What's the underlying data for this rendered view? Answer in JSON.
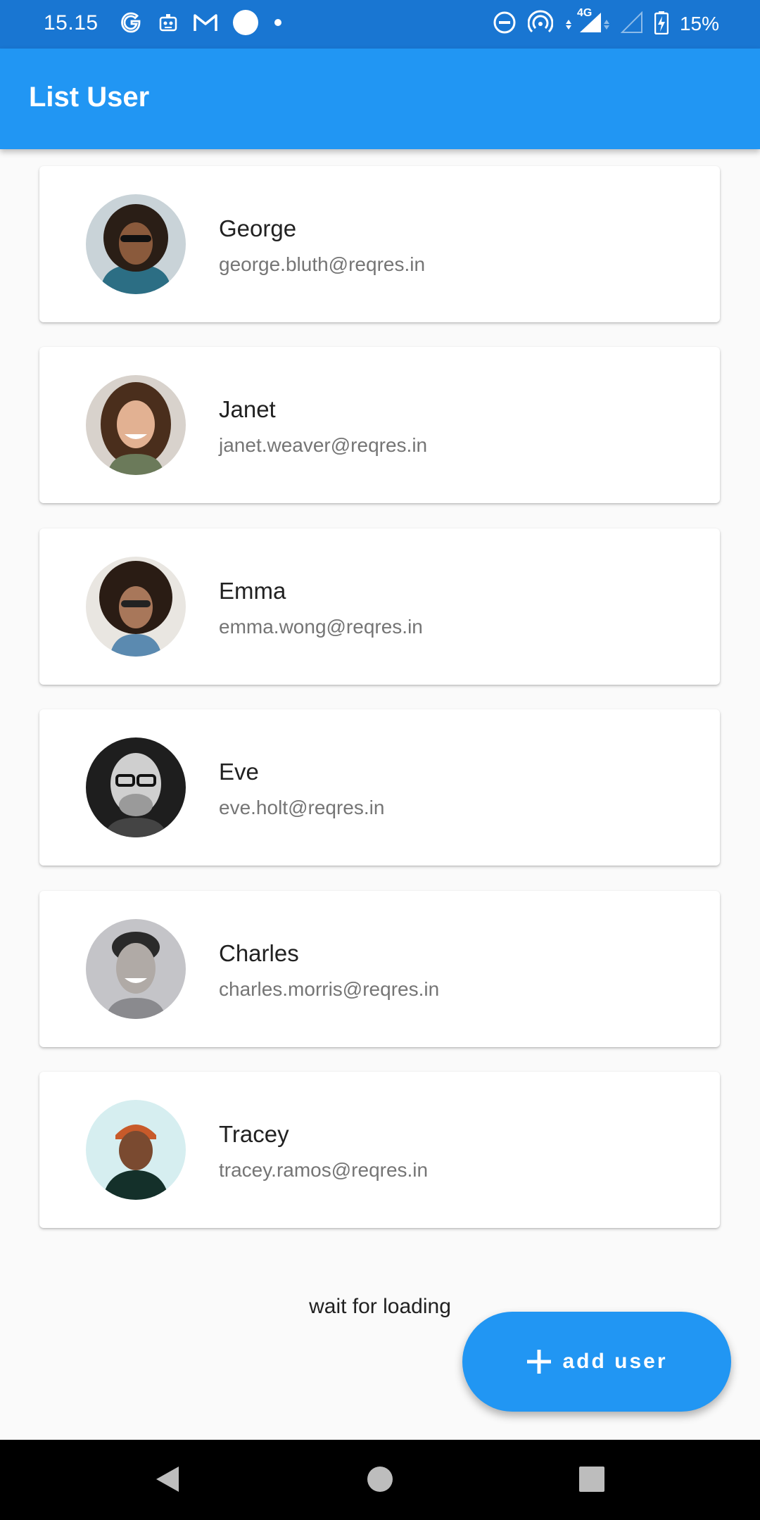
{
  "status_bar": {
    "time": "15.15",
    "network": "4G",
    "battery": "15%"
  },
  "app_bar": {
    "title": "List User"
  },
  "users": [
    {
      "name": "George",
      "email": "george.bluth@reqres.in"
    },
    {
      "name": "Janet",
      "email": "janet.weaver@reqres.in"
    },
    {
      "name": "Emma",
      "email": "emma.wong@reqres.in"
    },
    {
      "name": "Eve",
      "email": "eve.holt@reqres.in"
    },
    {
      "name": "Charles",
      "email": "charles.morris@reqres.in"
    },
    {
      "name": "Tracey",
      "email": "tracey.ramos@reqres.in"
    }
  ],
  "loading_text": "wait for loading",
  "fab": {
    "label": "add user",
    "icon": "plus-icon"
  },
  "colors": {
    "status_bar": "#1976d2",
    "app_bar": "#2196f3",
    "fab": "#2196f3",
    "background": "#fafafa"
  }
}
